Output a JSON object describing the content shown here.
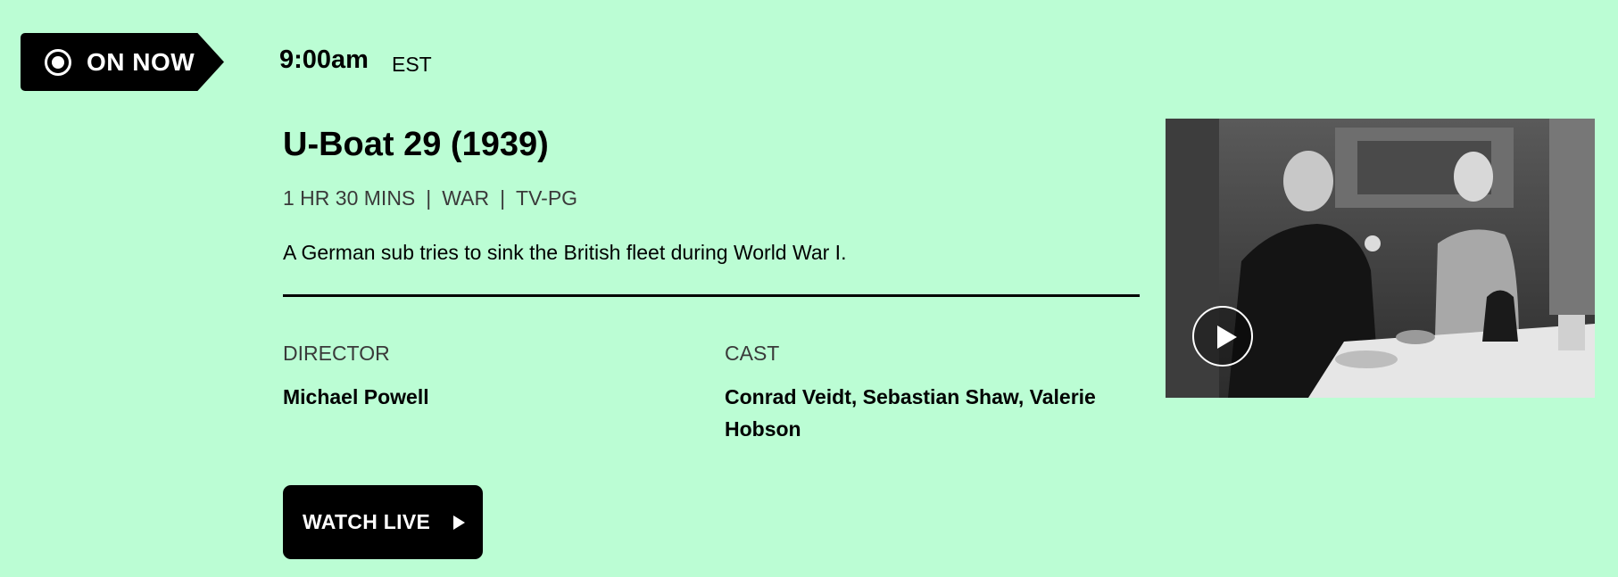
{
  "badge": {
    "label": "ON NOW",
    "icon": "live-radio-icon"
  },
  "schedule": {
    "time": "9:00am",
    "timezone": "EST"
  },
  "program": {
    "title": "U-Boat 29 (1939)",
    "duration": "1 HR 30 MINS",
    "genre": "WAR",
    "rating": "TV-PG",
    "separator": "|",
    "description": "A German sub tries to sink the British fleet during World War I."
  },
  "credits": {
    "director_label": "DIRECTOR",
    "director": "Michael Powell",
    "cast_label": "CAST",
    "cast": "Conrad Veidt, Sebastian Shaw, Valerie Hobson"
  },
  "actions": {
    "watch_label": "WATCH LIVE",
    "watch_icon": "play-icon"
  },
  "thumbnail": {
    "icon": "play-circle-icon"
  },
  "colors": {
    "background": "#bbfdd4",
    "button": "#000000",
    "button_text": "#ffffff"
  }
}
